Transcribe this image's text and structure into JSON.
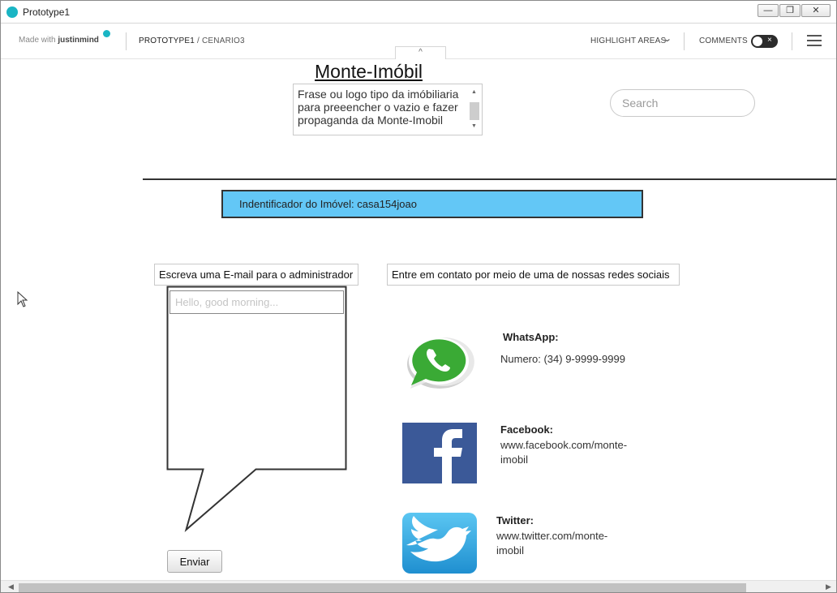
{
  "window": {
    "title": "Prototype1",
    "controls": {
      "minimize": "—",
      "restore": "❐",
      "close": "✕"
    }
  },
  "toolbar": {
    "made_with": "Made with",
    "brand": "justinmind",
    "project": "PROTOTYPE1",
    "screen": " / CENARIO3",
    "highlight_areas": "HIGHLIGHT AREAS",
    "comments": "COMMENTS",
    "toggle_x": "×",
    "collapse_glyph": "^"
  },
  "header": {
    "site_title": "Monte-Imóbil",
    "slogan": "Frase ou logo tipo da imóbiliaria para preeencher o vazio e fazer propaganda da Monte-Imobil",
    "search_placeholder": "Search"
  },
  "property": {
    "identifier": "Indentificador do Imóvel: casa154joao"
  },
  "email_section": {
    "label": "Escreva uma E-mail para o administrador",
    "message_placeholder": "Hello, good morning...",
    "send_label": "Enviar"
  },
  "contact_section": {
    "label": "Entre em contato por meio de uma de nossas redes sociais",
    "whatsapp": {
      "name": "WhatsApp:",
      "number": "Numero: (34) 9-9999-9999"
    },
    "facebook": {
      "name": "Facebook:",
      "url": "www.facebook.com/monte-imobil"
    },
    "twitter": {
      "name": "Twitter:",
      "url": "www.twitter.com/monte-imobil"
    }
  },
  "colors": {
    "accent": "#1ab5c4",
    "identifier_bg": "#63c7f6",
    "facebook": "#3b5998",
    "whatsapp": "#3aaa35",
    "twitter": "#2aa3e3"
  },
  "icons": {
    "app": "justinmind-dot-icon",
    "menu": "hamburger-menu-icon",
    "cursor": "mouse-pointer-icon"
  }
}
